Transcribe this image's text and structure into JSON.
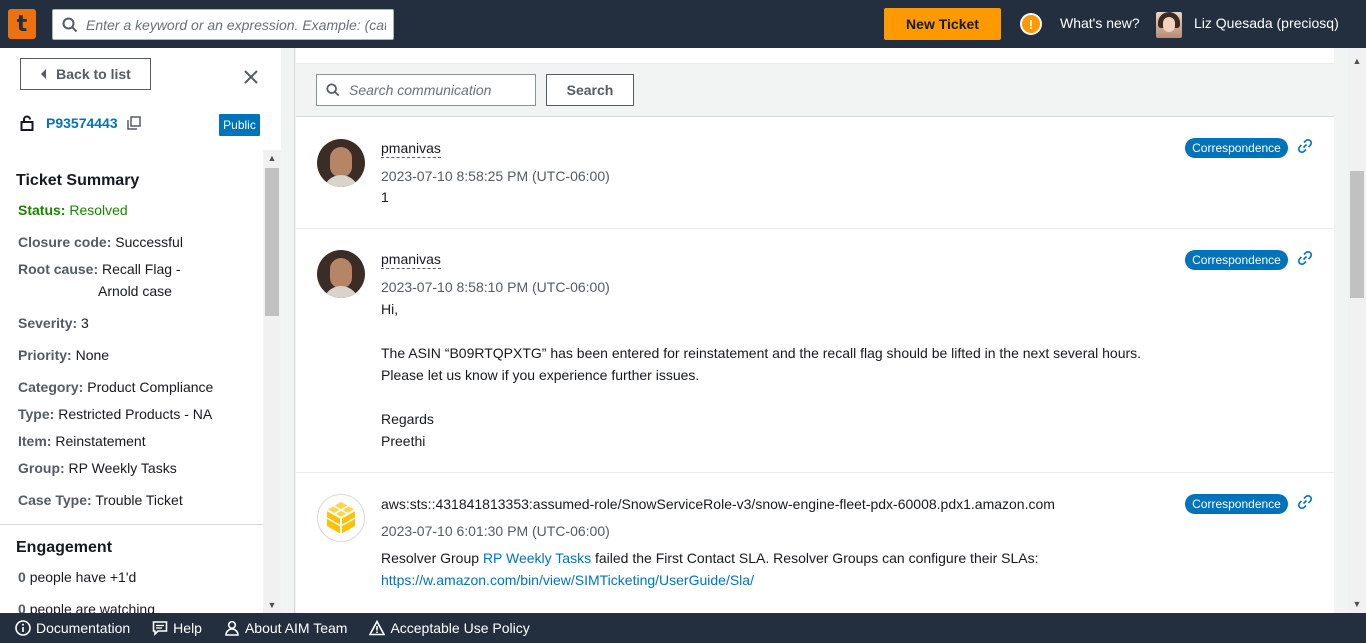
{
  "topbar": {
    "logo": "t",
    "search_placeholder": "Enter a keyword or an expression. Example: (cat OR dog) AND \"NOT\" fish",
    "new_ticket_label": "New Ticket",
    "whats_new_label": "What's new?",
    "user_name": "Liz Quesada (preciosq)"
  },
  "sidebar": {
    "back_label": "Back to list",
    "ticket_id": "P93574443",
    "visibility_badge": "Public",
    "ticket_summary_title": "Ticket Summary",
    "fields": {
      "status_label": "Status:",
      "status_value": "Resolved",
      "closure_label": "Closure code:",
      "closure_value": "Successful",
      "root_cause_label": "Root cause:",
      "root_cause_value_line1": "Recall Flag -",
      "root_cause_value_line2": "Arnold case",
      "severity_label": "Severity:",
      "severity_value": "3",
      "priority_label": "Priority:",
      "priority_value": "None",
      "category_label": "Category:",
      "category_value": "Product Compliance",
      "type_label": "Type:",
      "type_value": "Restricted Products - NA",
      "item_label": "Item:",
      "item_value": "Reinstatement",
      "group_label": "Group:",
      "group_value": "RP Weekly Tasks",
      "case_type_label": "Case Type:",
      "case_type_value": "Trouble Ticket"
    },
    "engagement_title": "Engagement",
    "plus_one_count": "0",
    "plus_one_text": "people have +1'd",
    "watching_count": "0",
    "watching_text": "people are watching"
  },
  "main": {
    "search_placeholder": "Search communication",
    "search_button": "Search",
    "messages": [
      {
        "author": "pmanivas",
        "timestamp": "2023-07-10 8:58:25 PM (UTC-06:00)",
        "badge": "Correspondence",
        "body_line1": "1"
      },
      {
        "author": "pmanivas",
        "timestamp": "2023-07-10 8:58:10 PM (UTC-06:00)",
        "badge": "Correspondence",
        "body_line1": "Hi,",
        "body_line2": "The ASIN “B09RTQPXTG” has been entered for reinstatement and the recall flag should be lifted in the next several hours.",
        "body_line3": "Please let us know if you experience further issues.",
        "body_line4": "Regards",
        "body_line5": "Preethi"
      },
      {
        "author": "aws:sts::431841813353:assumed-role/SnowServiceRole-v3/snow-engine-fleet-pdx-60008.pdx1.amazon.com",
        "timestamp": "2023-07-10 6:01:30 PM (UTC-06:00)",
        "badge": "Correspondence",
        "body_prefix": "Resolver Group ",
        "body_link": "RP Weekly Tasks",
        "body_suffix": " failed the First Contact SLA. Resolver Groups can configure their SLAs:",
        "body_url": "https://w.amazon.com/bin/view/SIMTicketing/UserGuide/Sla/"
      }
    ]
  },
  "footer": {
    "documentation": "Documentation",
    "help": "Help",
    "about": "About AIM Team",
    "policy": "Acceptable Use Policy"
  },
  "colors": {
    "topbar_bg": "#232f3e",
    "accent_orange": "#ff9900",
    "link_blue": "#0073bb",
    "status_green": "#1d8102"
  },
  "icons": [
    "search-icon",
    "alert-icon",
    "chevron-left-icon",
    "close-icon",
    "lock-icon",
    "copy-icon",
    "link-icon",
    "info-icon",
    "chat-icon",
    "person-icon",
    "warning-icon"
  ]
}
